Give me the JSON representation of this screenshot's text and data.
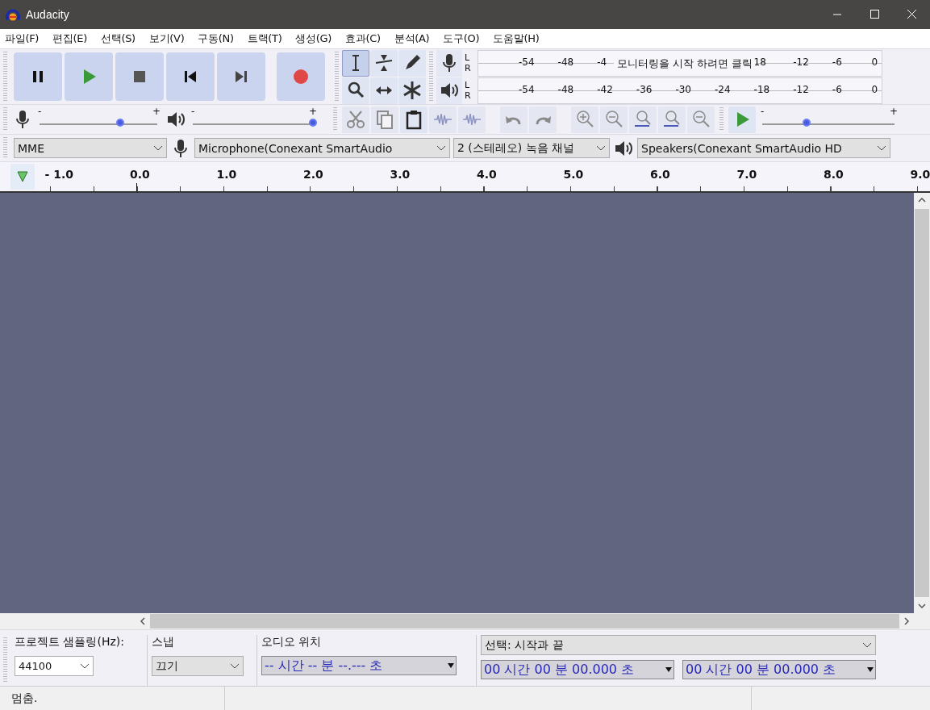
{
  "window": {
    "title": "Audacity"
  },
  "menu": [
    "파일(F)",
    "편집(E)",
    "선택(S)",
    "보기(V)",
    "구동(N)",
    "트랙(T)",
    "생성(G)",
    "효과(C)",
    "분석(A)",
    "도구(O)",
    "도움말(H)"
  ],
  "transport": [
    {
      "kind": "pause"
    },
    {
      "kind": "play"
    },
    {
      "kind": "stop"
    },
    {
      "kind": "skip-start"
    },
    {
      "kind": "skip-end"
    },
    {
      "kind": "record"
    }
  ],
  "tools": [
    {
      "kind": "select",
      "selected": true
    },
    {
      "kind": "envelope",
      "selected": false
    },
    {
      "kind": "draw",
      "selected": false
    },
    {
      "kind": "zoom",
      "selected": false
    },
    {
      "kind": "timeshift",
      "selected": false
    },
    {
      "kind": "multi",
      "selected": false
    }
  ],
  "record_meter": {
    "channels": [
      "L",
      "R"
    ],
    "ticks_before": [
      "-54",
      "-48",
      "-4"
    ],
    "message": "모니터링을 시작 하려면 클릭",
    "ticks_after": [
      "18",
      "-12",
      "-6",
      "0"
    ]
  },
  "play_meter": {
    "channels": [
      "L",
      "R"
    ],
    "ticks": [
      "-54",
      "-48",
      "-42",
      "-36",
      "-30",
      "-24",
      "-18",
      "-12",
      "-6",
      "0"
    ]
  },
  "record_volume": {
    "min_label": "-",
    "max_label": "+",
    "level": 0.69
  },
  "play_volume": {
    "min_label": "-",
    "max_label": "+",
    "level": 1.0
  },
  "edit_tools": [
    {
      "kind": "cut",
      "disabled": true
    },
    {
      "kind": "copy",
      "disabled": true
    },
    {
      "kind": "paste",
      "disabled": false
    },
    {
      "kind": "trim",
      "disabled": true
    },
    {
      "kind": "silence",
      "disabled": true
    }
  ],
  "history": [
    {
      "kind": "undo",
      "disabled": true
    },
    {
      "kind": "redo",
      "disabled": true
    }
  ],
  "zoom_tools": [
    {
      "kind": "zoom-in",
      "disabled": true
    },
    {
      "kind": "zoom-out",
      "disabled": true
    },
    {
      "kind": "fit-selection",
      "disabled": true
    },
    {
      "kind": "fit-project",
      "disabled": true
    },
    {
      "kind": "zoom-toggle",
      "disabled": true
    }
  ],
  "play_speed": {
    "min_label": "-",
    "max_label": "+",
    "level": 0.34
  },
  "devices": {
    "host": "MME",
    "microphone": "Microphone(Conexant SmartAudio",
    "channels": "2 (스테레오) 녹음 채널",
    "speakers": "Speakers(Conexant SmartAudio HD"
  },
  "ruler": {
    "labels": [
      "- 1.0",
      "0.0",
      "1.0",
      "2.0",
      "3.0",
      "4.0",
      "5.0",
      "6.0",
      "7.0",
      "8.0",
      "9.0"
    ]
  },
  "selection_bar": {
    "rate_label": "프로젝트 샘플링(Hz):",
    "rate": "44100",
    "snap_label": "스냅",
    "snap": "끄기",
    "position_label": "오디오 위치",
    "position": "-- 시간 -- 분 --.--- 초",
    "selection_label": "선택: 시작과 끝",
    "start": "00 시간 00 분 00.000 초",
    "end": "00 시간 00 분 00.000 초"
  },
  "status_bar": {
    "text": "멈춤."
  }
}
